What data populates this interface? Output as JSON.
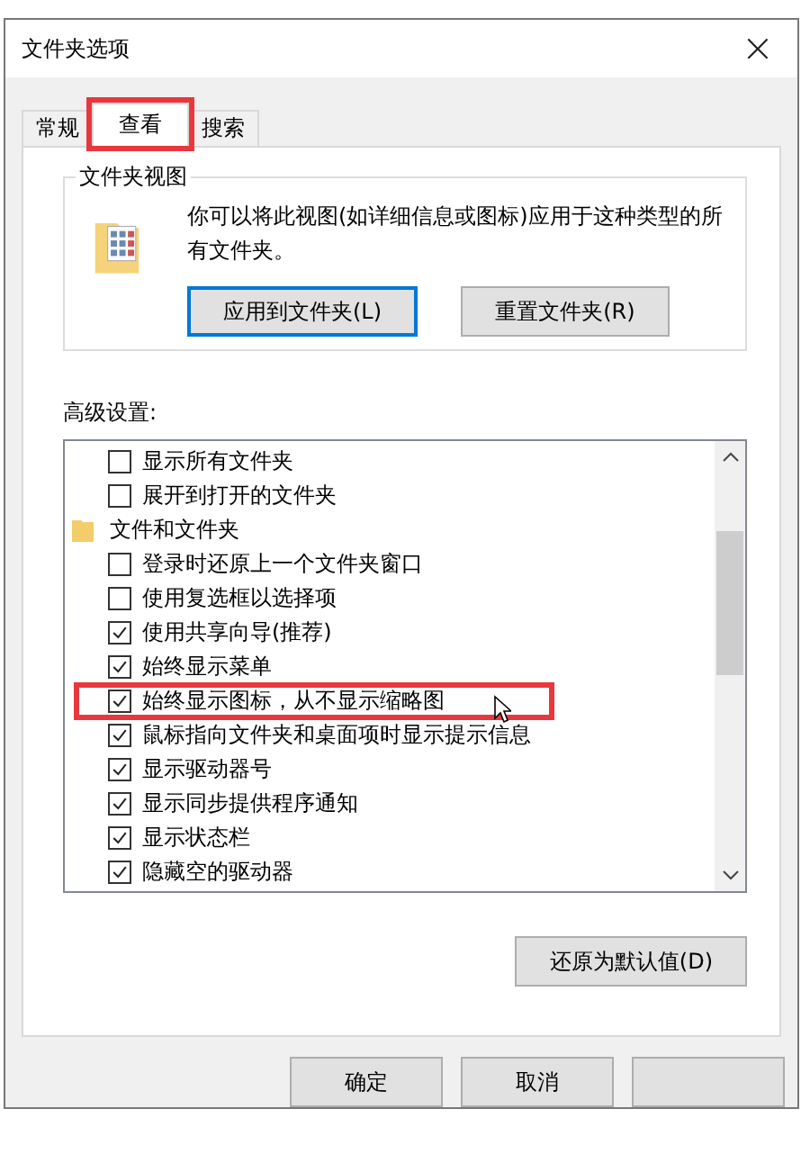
{
  "window": {
    "title": "文件夹选项",
    "close": "×"
  },
  "tabs": [
    {
      "label": "常规",
      "selected": false,
      "highlighted": false
    },
    {
      "label": "查看",
      "selected": true,
      "highlighted": true
    },
    {
      "label": "搜索",
      "selected": false,
      "highlighted": false
    }
  ],
  "folder_views": {
    "title": "文件夹视图",
    "description": "你可以将此视图(如详细信息或图标)应用于这种类型的所有文件夹。",
    "buttons": [
      {
        "label": "应用到文件夹(L)",
        "focused": true
      },
      {
        "label": "重置文件夹(R)",
        "focused": false
      }
    ]
  },
  "advanced": {
    "label": "高级设置:",
    "items": [
      {
        "kind": "checkbox",
        "label": "显示所有文件夹",
        "checked": false,
        "highlighted": false
      },
      {
        "kind": "checkbox",
        "label": "展开到打开的文件夹",
        "checked": false,
        "highlighted": false
      },
      {
        "kind": "folder",
        "label": "文件和文件夹",
        "children": [
          {
            "kind": "checkbox",
            "label": "登录时还原上一个文件夹窗口",
            "checked": false,
            "highlighted": false
          },
          {
            "kind": "checkbox",
            "label": "使用复选框以选择项",
            "checked": false,
            "highlighted": false
          },
          {
            "kind": "checkbox",
            "label": "使用共享向导(推荐)",
            "checked": true,
            "highlighted": false
          },
          {
            "kind": "checkbox",
            "label": "始终显示菜单",
            "checked": true,
            "highlighted": false
          },
          {
            "kind": "checkbox",
            "label": "始终显示图标，从不显示缩略图",
            "checked": true,
            "highlighted": true
          },
          {
            "kind": "checkbox",
            "label": "鼠标指向文件夹和桌面项时显示提示信息",
            "checked": true,
            "highlighted": false
          },
          {
            "kind": "checkbox",
            "label": "显示驱动器号",
            "checked": true,
            "highlighted": false
          },
          {
            "kind": "checkbox",
            "label": "显示同步提供程序通知",
            "checked": true,
            "highlighted": false
          },
          {
            "kind": "checkbox",
            "label": "显示状态栏",
            "checked": true,
            "highlighted": false
          },
          {
            "kind": "checkbox",
            "label": "隐藏空的驱动器",
            "checked": true,
            "highlighted": false
          }
        ]
      }
    ],
    "restore_button": "还原为默认值(D)"
  },
  "buttons": [
    {
      "kind": "text",
      "label": "确定"
    },
    {
      "kind": "text",
      "label": "取消"
    },
    {
      "kind": "blank"
    }
  ]
}
